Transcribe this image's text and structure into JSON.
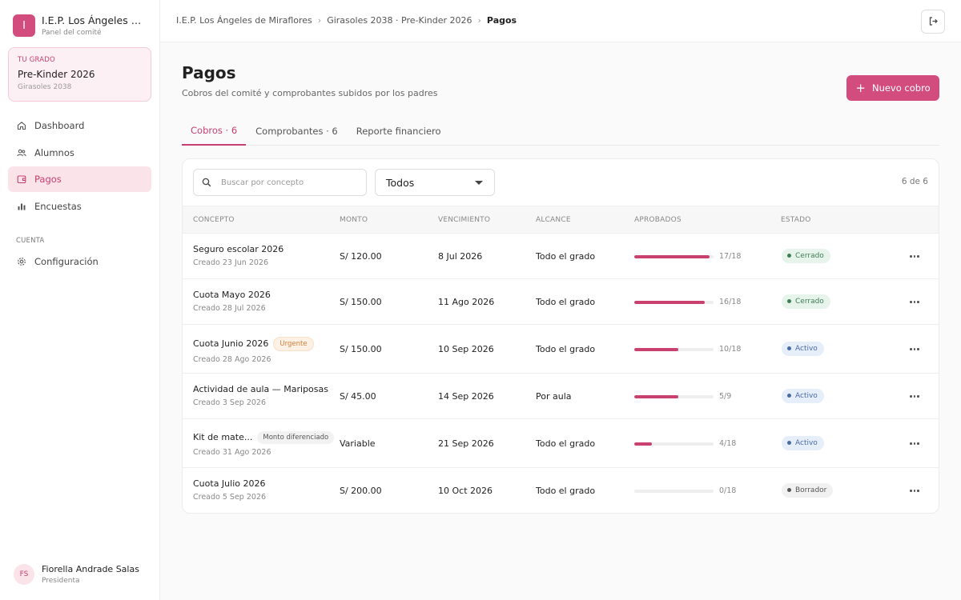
{
  "brand": {
    "logo_letter": "I",
    "name": "I.E.P. Los Ángeles de Miraflores",
    "subtitle": "Panel del comité"
  },
  "grade": {
    "kicker": "TU GRADO",
    "title": "Pre-Kinder 2026",
    "subtitle": "Girasoles 2038"
  },
  "nav": [
    {
      "label": "Dashboard",
      "icon": "home-icon"
    },
    {
      "label": "Alumnos",
      "icon": "users-icon"
    },
    {
      "label": "Pagos",
      "icon": "wallet-icon",
      "active": true
    },
    {
      "label": "Encuestas",
      "icon": "bar-chart-icon"
    }
  ],
  "account": {
    "section_label": "CUENTA",
    "settings_label": "Configuración"
  },
  "user": {
    "initials": "FS",
    "name": "Fiorella Andrade Salas",
    "role": "Presidenta"
  },
  "breadcrumb": [
    "I.E.P. Los Ángeles de Miraflores",
    "Girasoles 2038 · Pre-Kinder 2026",
    "Pagos"
  ],
  "page": {
    "title": "Pagos",
    "subtitle": "Cobros del comité y comprobantes subidos por los padres",
    "new_button": "Nuevo cobro"
  },
  "tabs": [
    {
      "label": "Cobros · 6",
      "active": true
    },
    {
      "label": "Comprobantes · 6"
    },
    {
      "label": "Reporte financiero"
    }
  ],
  "filters": {
    "search_placeholder": "Buscar por concepto",
    "select_value": "Todos",
    "count_text": "6 de 6"
  },
  "columns": [
    "CONCEPTO",
    "MONTO",
    "VENCIMIENTO",
    "ALCANCE",
    "APROBADOS",
    "ESTADO"
  ],
  "rows": [
    {
      "title": "Seguro escolar 2026",
      "created": "Creado 23 Jun 2026",
      "tag": "",
      "amount": "S/ 120.00",
      "due": "8 Jul 2026",
      "scope": "Todo el grado",
      "approved": 17,
      "total": 18,
      "ratio": "17/18",
      "status": "Cerrado",
      "status_type": "closed"
    },
    {
      "title": "Cuota Mayo 2026",
      "created": "Creado 28 Jul 2026",
      "tag": "",
      "amount": "S/ 150.00",
      "due": "11 Ago 2026",
      "scope": "Todo el grado",
      "approved": 16,
      "total": 18,
      "ratio": "16/18",
      "status": "Cerrado",
      "status_type": "closed"
    },
    {
      "title": "Cuota Junio 2026",
      "created": "Creado 28 Ago 2026",
      "tag": "Urgente",
      "tag_type": "urgent",
      "amount": "S/ 150.00",
      "due": "10 Sep 2026",
      "scope": "Todo el grado",
      "approved": 10,
      "total": 18,
      "ratio": "10/18",
      "status": "Activo",
      "status_type": "active"
    },
    {
      "title": "Actividad de aula — Mariposas",
      "created": "Creado 3 Sep 2026",
      "tag": "",
      "amount": "S/ 45.00",
      "due": "14 Sep 2026",
      "scope": "Por aula",
      "approved": 5,
      "total": 9,
      "ratio": "5/9",
      "status": "Activo",
      "status_type": "active"
    },
    {
      "title": "Kit de mate...",
      "created": "Creado 31 Ago 2026",
      "tag": "Monto diferenciado",
      "tag_type": "diff",
      "amount": "Variable",
      "due": "21 Sep 2026",
      "scope": "Todo el grado",
      "approved": 4,
      "total": 18,
      "ratio": "4/18",
      "status": "Activo",
      "status_type": "active"
    },
    {
      "title": "Cuota Julio 2026",
      "created": "Creado 5 Sep 2026",
      "tag": "",
      "amount": "S/ 200.00",
      "due": "10 Oct 2026",
      "scope": "Todo el grado",
      "approved": 0,
      "total": 18,
      "ratio": "0/18",
      "status": "Borrador",
      "status_type": "draft"
    }
  ],
  "colors": {
    "accent": "#d24d7d",
    "accent_soft": "#fbe3ea",
    "progress": "#c9426f"
  }
}
